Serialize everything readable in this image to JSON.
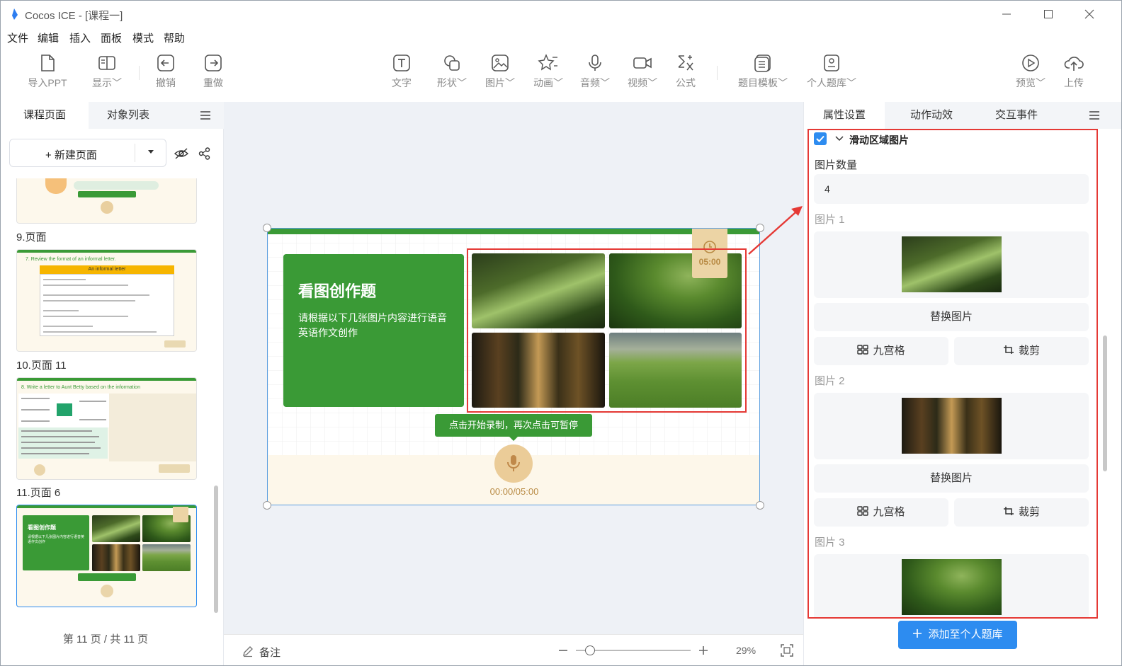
{
  "window": {
    "app_name": "Cocos ICE - [课程一]"
  },
  "menu": [
    "文件",
    "编辑",
    "插入",
    "面板",
    "模式",
    "帮助"
  ],
  "toolbar": {
    "import_ppt": "导入PPT",
    "display": "显示",
    "undo": "撤销",
    "redo": "重做",
    "text": "文字",
    "shape": "形状",
    "image": "图片",
    "animation": "动画",
    "audio": "音频",
    "video": "视频",
    "formula": "公式",
    "template": "题目模板",
    "personal_bank": "个人题库",
    "preview": "预览",
    "upload": "上传"
  },
  "left_panel": {
    "tabs": [
      "课程页面",
      "对象列表"
    ],
    "new_page": "+ 新建页面",
    "pages": [
      {
        "label": "9.页面"
      },
      {
        "label": "10.页面 11",
        "title": "7. Review the format of an informal letter.",
        "header": "An informal letter"
      },
      {
        "label": "11.页面 6",
        "title": "8. Write a letter to Aunt Betty based on the information"
      },
      {
        "label": ""
      }
    ],
    "page_counter": "第 11 页 / 共 11 页"
  },
  "slide": {
    "title": "看图创作题",
    "description": "请根据以下几张图片内容进行语音英语作文创作",
    "timer": "05:00",
    "record_tip": "点击开始录制，再次点击可暂停",
    "record_time": "00:00/05:00"
  },
  "bottom_bar": {
    "notes": "备注",
    "zoom": "29%",
    "zoom_level": 0.08
  },
  "right_panel": {
    "tabs": [
      "属性设置",
      "动作动效",
      "交互事件"
    ],
    "section_title": "滑动区域图片",
    "count_label": "图片数量",
    "count_value": "4",
    "images": [
      {
        "label": "图片 1",
        "replace": "替换图片",
        "grid": "九宫格",
        "crop": "裁剪"
      },
      {
        "label": "图片 2",
        "replace": "替换图片",
        "grid": "九宫格",
        "crop": "裁剪"
      },
      {
        "label": "图片 3"
      }
    ],
    "add_button": "添加至个人题库"
  },
  "colors": {
    "accent": "#2d8cf0",
    "slide_green": "#3a9a36",
    "annotation_red": "#e53935"
  }
}
